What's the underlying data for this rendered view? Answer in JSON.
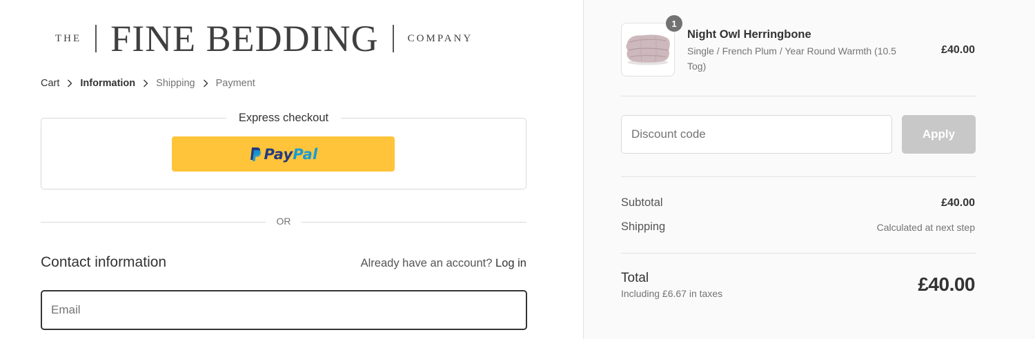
{
  "brand": {
    "prefix": "THE",
    "name": "FINE BEDDING",
    "suffix": "COMPANY"
  },
  "breadcrumb": [
    "Cart",
    "Information",
    "Shipping",
    "Payment"
  ],
  "express": {
    "title": "Express checkout",
    "paypal_pay": "Pay",
    "paypal_pal": "Pal"
  },
  "divider_text": "OR",
  "contact": {
    "title": "Contact information",
    "account_prompt": "Already have an account?",
    "login_label": "Log in",
    "email_placeholder": "Email",
    "email_value": ""
  },
  "order": {
    "item": {
      "quantity": "1",
      "name": "Night Owl Herringbone",
      "variant": "Single / French Plum / Year Round Warmth (10.5 Tog)",
      "price": "£40.00",
      "thumb_icon": "duvet-thumbnail"
    },
    "discount_placeholder": "Discount code",
    "discount_value": "",
    "apply_label": "Apply",
    "subtotal_label": "Subtotal",
    "subtotal_value": "£40.00",
    "shipping_label": "Shipping",
    "shipping_value": "Calculated at next step",
    "total_label": "Total",
    "total_tax": "Including £6.67 in taxes",
    "total_value": "£40.00"
  },
  "colors": {
    "paypal_yellow": "#ffc439",
    "paypal_dark_blue": "#253b80",
    "paypal_light_blue": "#179bd7",
    "apply_disabled": "#c8c8c8",
    "badge": "#727272",
    "sidebar_bg": "#fafafa"
  }
}
